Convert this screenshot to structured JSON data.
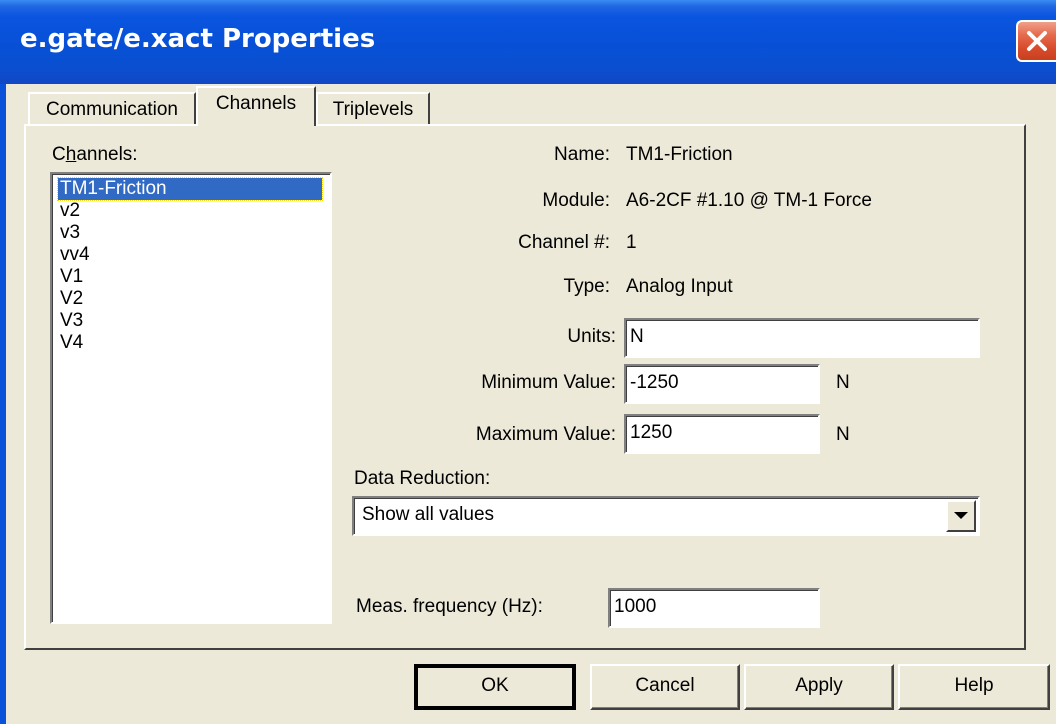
{
  "window": {
    "title": "e.gate/e.xact Properties"
  },
  "tabs": [
    {
      "label": "Communication",
      "active": false
    },
    {
      "label": "Channels",
      "active": true
    },
    {
      "label": "Triplevels",
      "active": false
    }
  ],
  "channels_list": {
    "label_pre": "C",
    "label_accel": "h",
    "label_post": "annels:",
    "items": [
      "TM1-Friction",
      "v2",
      "v3",
      "vv4",
      "V1",
      "V2",
      "V3",
      "V4"
    ],
    "selected": "TM1-Friction"
  },
  "fields": {
    "name_label": "Name:",
    "name_value": "TM1-Friction",
    "module_label": "Module:",
    "module_value": "A6-2CF #1.10 @ TM-1 Force",
    "channel_label": "Channel #:",
    "channel_value": "1",
    "type_label": "Type:",
    "type_value": "Analog Input",
    "units_label": "Units:",
    "units_value": "N",
    "min_label": "Minimum Value:",
    "min_value": "-1250",
    "min_unit": "N",
    "max_label": "Maximum Value:",
    "max_value": "1250",
    "max_unit": "N"
  },
  "data_reduction": {
    "label": "Data Reduction:",
    "selected": "Show all values"
  },
  "frequency": {
    "label": "Meas. frequency (Hz):",
    "value": "1000"
  },
  "buttons": {
    "ok": "OK",
    "cancel": "Cancel",
    "apply": "Apply",
    "help": "Help"
  },
  "icons": {
    "close": "close-icon",
    "dropdown": "chevron-down-icon"
  },
  "colors": {
    "titlebar": "#0750d6",
    "selection": "#316ac5",
    "dialog_bg": "#ece9d8",
    "close_button": "#d74b2b"
  }
}
